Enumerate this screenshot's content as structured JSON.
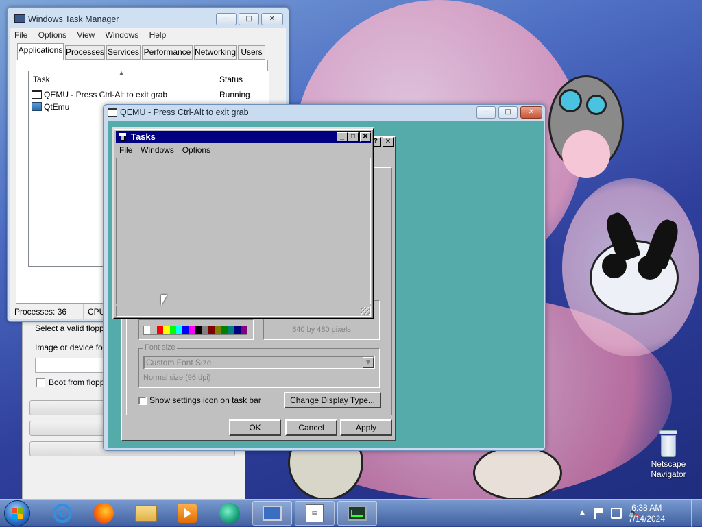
{
  "desktop": {
    "icon_label_1": "Netscape",
    "icon_label_2": "Navigator"
  },
  "task_manager": {
    "title": "Windows Task Manager",
    "menu": [
      "File",
      "Options",
      "View",
      "Windows",
      "Help"
    ],
    "tabs": [
      "Applications",
      "Processes",
      "Services",
      "Performance",
      "Networking",
      "Users"
    ],
    "columns": {
      "task": "Task",
      "status": "Status"
    },
    "rows": [
      {
        "task": "QEMU - Press Ctrl-Alt to exit grab",
        "status": "Running"
      },
      {
        "task": "QtEmu",
        "status": ""
      }
    ],
    "status": {
      "processes": "Processes: 36",
      "cpu": "CPU"
    }
  },
  "qtemu_window": {
    "floppy_label": "Select a valid floppy",
    "image_label": "Image or device for f",
    "boot_checkbox": "Boot from floppy"
  },
  "qemu": {
    "title": "QEMU - Press Ctrl-Alt to exit grab"
  },
  "display_dialog": {
    "resolution_text": "640 by 480 pixels",
    "font_size_group": "Font size",
    "font_size_value": "Custom Font Size",
    "font_size_note": "Normal size (96 dpi)",
    "show_icon_checkbox": "Show settings icon on task bar",
    "change_type_button": "Change Display Type...",
    "ok_button": "OK",
    "cancel_button": "Cancel",
    "apply_button": "Apply"
  },
  "tasks_window": {
    "title": "Tasks",
    "menu": [
      "File",
      "Windows",
      "Options"
    ]
  },
  "taskbar": {
    "time": "6:38 AM",
    "date": "7/14/2024"
  },
  "colors": {
    "qemu_desktop": "#55aaaa",
    "win31_titlebar": "#000080",
    "win31_face": "#c0c0c0"
  }
}
